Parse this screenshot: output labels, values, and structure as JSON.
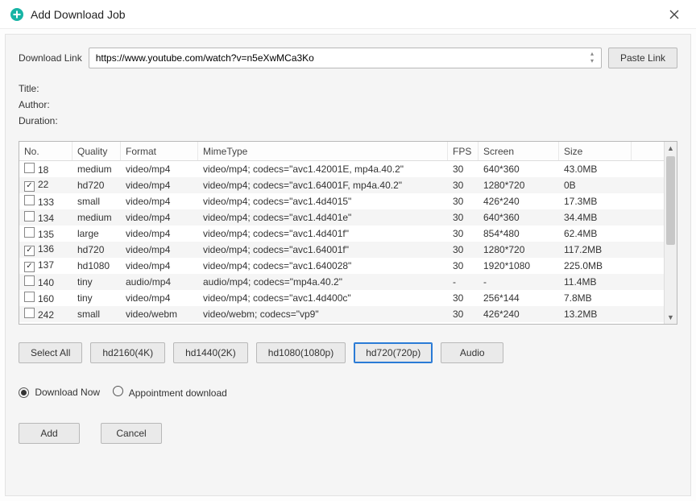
{
  "window": {
    "title": "Add Download Job"
  },
  "url_row": {
    "label": "Download Link",
    "value": "https://www.youtube.com/watch?v=n5eXwMCa3Ko",
    "paste_btn": "Paste Link"
  },
  "meta": {
    "title_label": "Title:",
    "author_label": "Author:",
    "duration_label": "Duration:"
  },
  "columns": {
    "no": "No.",
    "quality": "Quality",
    "format": "Format",
    "mime": "MimeType",
    "fps": "FPS",
    "screen": "Screen",
    "size": "Size"
  },
  "rows": [
    {
      "checked": false,
      "no": "18",
      "quality": "medium",
      "format": "video/mp4",
      "mime": "video/mp4; codecs=\"avc1.42001E, mp4a.40.2\"",
      "fps": "30",
      "screen": "640*360",
      "size": "43.0MB"
    },
    {
      "checked": true,
      "no": "22",
      "quality": "hd720",
      "format": "video/mp4",
      "mime": "video/mp4; codecs=\"avc1.64001F, mp4a.40.2\"",
      "fps": "30",
      "screen": "1280*720",
      "size": "0B"
    },
    {
      "checked": false,
      "no": "133",
      "quality": "small",
      "format": "video/mp4",
      "mime": "video/mp4; codecs=\"avc1.4d4015\"",
      "fps": "30",
      "screen": "426*240",
      "size": "17.3MB"
    },
    {
      "checked": false,
      "no": "134",
      "quality": "medium",
      "format": "video/mp4",
      "mime": "video/mp4; codecs=\"avc1.4d401e\"",
      "fps": "30",
      "screen": "640*360",
      "size": "34.4MB"
    },
    {
      "checked": false,
      "no": "135",
      "quality": "large",
      "format": "video/mp4",
      "mime": "video/mp4; codecs=\"avc1.4d401f\"",
      "fps": "30",
      "screen": "854*480",
      "size": "62.4MB"
    },
    {
      "checked": true,
      "no": "136",
      "quality": "hd720",
      "format": "video/mp4",
      "mime": "video/mp4; codecs=\"avc1.64001f\"",
      "fps": "30",
      "screen": "1280*720",
      "size": "117.2MB"
    },
    {
      "checked": true,
      "no": "137",
      "quality": "hd1080",
      "format": "video/mp4",
      "mime": "video/mp4; codecs=\"avc1.640028\"",
      "fps": "30",
      "screen": "1920*1080",
      "size": "225.0MB"
    },
    {
      "checked": false,
      "no": "140",
      "quality": "tiny",
      "format": "audio/mp4",
      "mime": "audio/mp4; codecs=\"mp4a.40.2\"",
      "fps": "-",
      "screen": "-",
      "size": "11.4MB"
    },
    {
      "checked": false,
      "no": "160",
      "quality": "tiny",
      "format": "video/mp4",
      "mime": "video/mp4; codecs=\"avc1.4d400c\"",
      "fps": "30",
      "screen": "256*144",
      "size": "7.8MB"
    },
    {
      "checked": false,
      "no": "242",
      "quality": "small",
      "format": "video/webm",
      "mime": "video/webm; codecs=\"vp9\"",
      "fps": "30",
      "screen": "426*240",
      "size": "13.2MB"
    }
  ],
  "filters": {
    "select_all": "Select All",
    "hd2160": "hd2160(4K)",
    "hd1440": "hd1440(2K)",
    "hd1080": "hd1080(1080p)",
    "hd720": "hd720(720p)",
    "audio": "Audio"
  },
  "schedule": {
    "now": "Download Now",
    "appointment": "Appointment download"
  },
  "actions": {
    "add": "Add",
    "cancel": "Cancel"
  }
}
